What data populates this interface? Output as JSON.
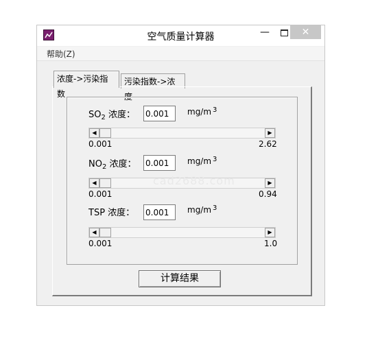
{
  "window": {
    "title": "空气质量计算器",
    "minimize_glyph": "—",
    "close_glyph": "✕",
    "icon": "app-chart-icon"
  },
  "menu": {
    "help": "帮助(Z)"
  },
  "tabs": [
    {
      "label": "浓度->污染指数",
      "active": true
    },
    {
      "label": "污染指数->浓度",
      "active": false
    }
  ],
  "pollutants": [
    {
      "name": "SO",
      "sub": "2",
      "suffix": " 浓度：",
      "value": "0.001",
      "unit": "mg/m",
      "unit_sup": "3",
      "min": "0.001",
      "max": "2.62",
      "slider_level": 0
    },
    {
      "name": "NO",
      "sub": "2",
      "suffix": " 浓度：",
      "value": "0.001",
      "unit": "mg/m",
      "unit_sup": "3",
      "min": "0.001",
      "max": "0.94",
      "slider_level": 0
    },
    {
      "name": "TSP",
      "sub": "",
      "suffix": " 浓度：",
      "value": "0.001",
      "unit": "mg/m",
      "unit_sup": "3",
      "min": "0.001",
      "max": "1.0",
      "slider_level": 0
    }
  ],
  "scroll_arrows": {
    "left": "◀",
    "right": "▶"
  },
  "calculate_button": "计算结果",
  "watermark": "cad2688.com"
}
